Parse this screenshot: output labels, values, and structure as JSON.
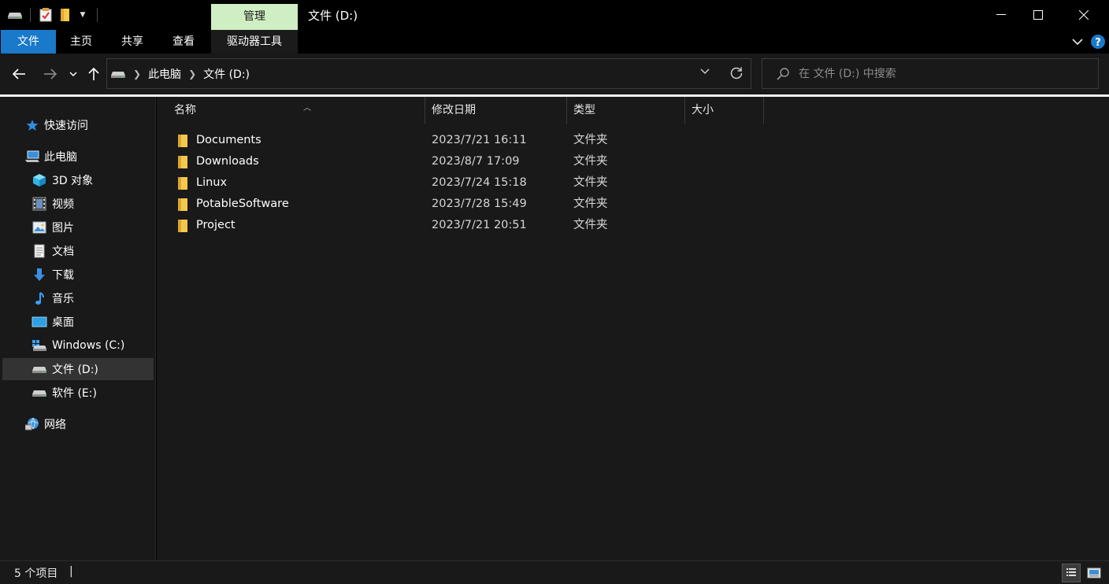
{
  "window": {
    "title": "文件 (D:)",
    "contextual_tab_group": "管理"
  },
  "ribbon": {
    "tabs": [
      "文件",
      "主页",
      "共享",
      "查看",
      "驱动器工具"
    ]
  },
  "address": {
    "crumbs": [
      "此电脑",
      "文件 (D:)"
    ]
  },
  "search": {
    "placeholder": "在 文件 (D:) 中搜索"
  },
  "sidebar": {
    "items": [
      {
        "label": "快速访问",
        "icon": "star-icon"
      },
      {
        "label": "此电脑",
        "icon": "computer-icon"
      },
      {
        "label": "3D 对象",
        "icon": "cube-icon"
      },
      {
        "label": "视频",
        "icon": "film-icon"
      },
      {
        "label": "图片",
        "icon": "picture-icon"
      },
      {
        "label": "文档",
        "icon": "document-icon"
      },
      {
        "label": "下载",
        "icon": "download-arrow-icon"
      },
      {
        "label": "音乐",
        "icon": "music-note-icon"
      },
      {
        "label": "桌面",
        "icon": "desktop-icon"
      },
      {
        "label": "Windows (C:)",
        "icon": "windows-drive-icon"
      },
      {
        "label": "文件 (D:)",
        "icon": "drive-icon"
      },
      {
        "label": "软件 (E:)",
        "icon": "drive-icon"
      },
      {
        "label": "网络",
        "icon": "network-icon"
      }
    ],
    "selected": "文件 (D:)"
  },
  "columns": [
    "名称",
    "修改日期",
    "类型",
    "大小"
  ],
  "files": [
    {
      "name": "Documents",
      "date": "2023/7/21 16:11",
      "type": "文件夹"
    },
    {
      "name": "Downloads",
      "date": "2023/8/7 17:09",
      "type": "文件夹"
    },
    {
      "name": "Linux",
      "date": "2023/7/24 15:18",
      "type": "文件夹"
    },
    {
      "name": "PotableSoftware",
      "date": "2023/7/28 15:49",
      "type": "文件夹"
    },
    {
      "name": "Project",
      "date": "2023/7/21 20:51",
      "type": "文件夹"
    }
  ],
  "status": {
    "item_count": "5 个项目",
    "caret": "|"
  },
  "colors": {
    "accent_blue": "#1979ca",
    "manage_green": "#cfeec3",
    "folder_yellow": "#f5c84c",
    "background": "#191919"
  }
}
